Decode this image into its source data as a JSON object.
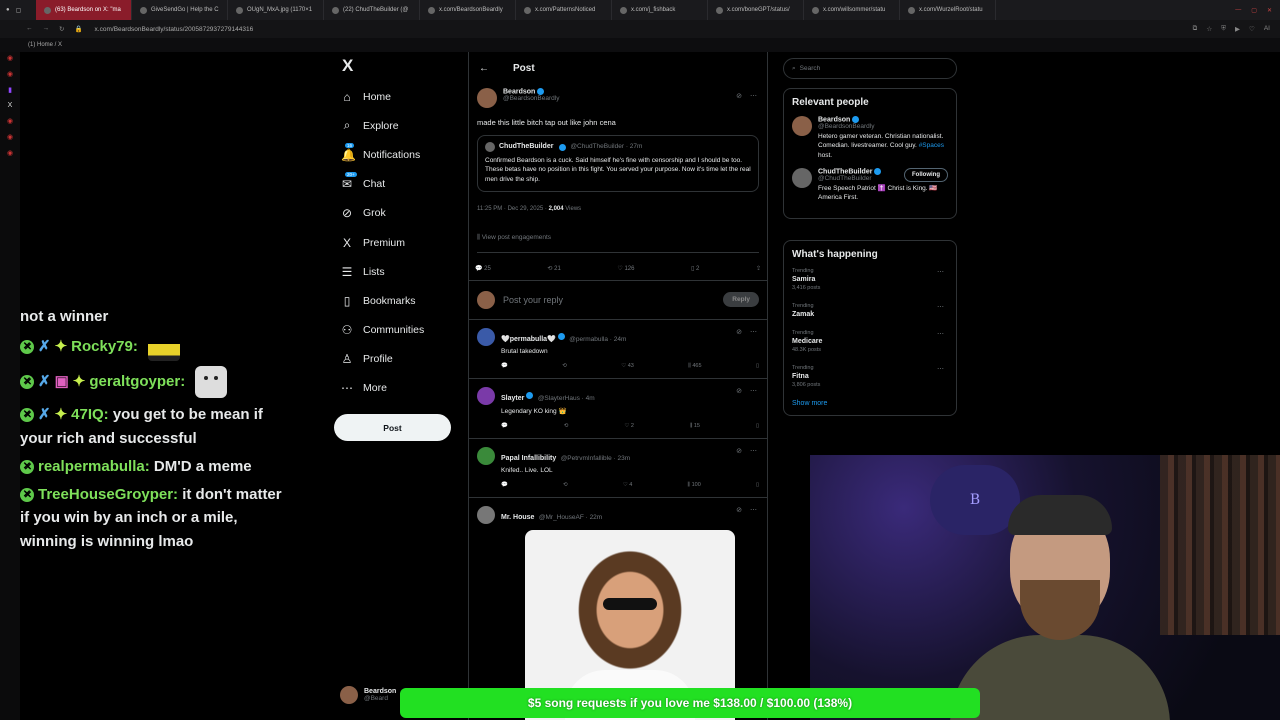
{
  "browser": {
    "tabs": [
      {
        "label": "(63) Beardson on X: \"ma",
        "active": true
      },
      {
        "label": "GiveSendGo | Help the C",
        "active": false
      },
      {
        "label": "OUgN_MxA.jpg (1170×1",
        "active": false
      },
      {
        "label": "(22) ChudTheBuilder (@",
        "active": false
      },
      {
        "label": "x.com/BeardsonBeardly",
        "active": false
      },
      {
        "label": "x.com/PatternsNoticed",
        "active": false
      },
      {
        "label": "x.com/j_fishback",
        "active": false
      },
      {
        "label": "x.com/boneGPT/status/",
        "active": false
      },
      {
        "label": "x.com/willsommer/statu",
        "active": false
      },
      {
        "label": "x.com/WurzelRoot/statu",
        "active": false
      }
    ],
    "url": "x.com/BeardsonBeardly/status/2005872937279144316",
    "bookmark": "(1) Home / X"
  },
  "chat": {
    "messages": [
      {
        "user": "",
        "text": "not a winner"
      },
      {
        "user": "Rocky79:",
        "text": ""
      },
      {
        "user": "geraltgoyper:",
        "text": ""
      },
      {
        "user": "47IQ:",
        "text": "you get to be mean if your rich and successful"
      },
      {
        "user": "realpermabulla:",
        "text": "DM'D a meme"
      },
      {
        "user": "TreeHouseGroyper:",
        "text": "it don't matter if you win by an inch or a mile, winning is winning lmao"
      }
    ]
  },
  "xnav": {
    "logo": "X",
    "items": [
      {
        "label": "Home",
        "icon": "home-icon",
        "glyph": "⌂"
      },
      {
        "label": "Explore",
        "icon": "search-icon",
        "glyph": "⌕"
      },
      {
        "label": "Notifications",
        "icon": "bell-icon",
        "glyph": "🔔",
        "count": "16"
      },
      {
        "label": "Chat",
        "icon": "chat-icon",
        "glyph": "✉",
        "count": "20+"
      },
      {
        "label": "Grok",
        "icon": "grok-icon",
        "glyph": "⊘"
      },
      {
        "label": "Premium",
        "icon": "x-icon",
        "glyph": "X"
      },
      {
        "label": "Lists",
        "icon": "list-icon",
        "glyph": "☰"
      },
      {
        "label": "Bookmarks",
        "icon": "bookmark-icon",
        "glyph": "▯"
      },
      {
        "label": "Communities",
        "icon": "people-icon",
        "glyph": "⚇"
      },
      {
        "label": "Profile",
        "icon": "person-icon",
        "glyph": "♙"
      },
      {
        "label": "More",
        "icon": "more-icon",
        "glyph": "⋯"
      }
    ],
    "post_button": "Post",
    "account": {
      "name": "Beardson",
      "handle": "@Beard"
    }
  },
  "main": {
    "header": "Post",
    "tweet": {
      "name": "Beardson",
      "handle": "@BeardsonBeardly",
      "text": "made this little bitch tap out like john cena",
      "quote": {
        "name": "ChudTheBuilder",
        "handle": "@ChudTheBuilder · 27m",
        "text": "Confirmed Beardson is a cuck. Said himself he's fine with censorship and I should be too. These betas have no position in this fight. You served your purpose. Now it's time let the real men drive the ship."
      },
      "time": "11:25 PM · Dec 29, 2025 · ",
      "views": "2,004",
      "views_label": " Views",
      "engagements": "View post engagements",
      "counts": {
        "replies": "25",
        "reposts": "21",
        "likes": "126",
        "bookmarks": "2"
      }
    },
    "reply_placeholder": "Post your reply",
    "reply_button": "Reply",
    "replies": [
      {
        "name": "🤍permabulla🤍",
        "handle": "@permabulla · 24m",
        "text": "Brutal takedown",
        "likes": "43",
        "views": "465",
        "avatar": "#3a5aa8"
      },
      {
        "name": "Slayter",
        "handle": "@SlayterHaus · 4m",
        "text": "Legendary KO king 👑",
        "likes": "2",
        "views": "15",
        "avatar": "#7a3aa8"
      },
      {
        "name": "Papal Infallibility",
        "handle": "@PetrvmInfallible · 23m",
        "text": "Knifed.. Live. LOL",
        "likes": "4",
        "views": "100",
        "avatar": "#3a8a3a"
      },
      {
        "name": "Mr. House",
        "handle": "@Mr_HouseAF · 22m",
        "text": "",
        "likes": "",
        "views": "",
        "avatar": "#777"
      }
    ]
  },
  "right": {
    "search_placeholder": "Search",
    "relevant_title": "Relevant people",
    "people": [
      {
        "name": "Beardson",
        "handle": "@BeardsonBeardly",
        "bio_pre": "Hetero gamer veteran. Christian nationalist. Comedian. livestreamer. Cool guy. ",
        "bio_link": "#Spaces",
        "bio_post": " host."
      },
      {
        "name": "ChudTheBuilder",
        "handle": "@ChudTheBuilder",
        "bio_pre": "Free Speech Patriot ✝️ Christ is King. 🇺🇸America First.",
        "bio_link": "",
        "bio_post": "",
        "follow": "Following"
      }
    ],
    "happening_title": "What's happening",
    "trends": [
      {
        "label": "Trending",
        "name": "Samira",
        "posts": "3,416 posts"
      },
      {
        "label": "Trending",
        "name": "Zamak",
        "posts": ""
      },
      {
        "label": "Trending",
        "name": "Medicare",
        "posts": "48.3K posts"
      },
      {
        "label": "Trending",
        "name": "Fitna",
        "posts": "3,806 posts"
      }
    ],
    "show_more": "Show more"
  },
  "overlay": {
    "donation": "$5 song requests if you love me $138.00 / $100.00 (138%)"
  },
  "colors": {
    "accent": "#1d9bf0",
    "chat_name": "#7ee05a",
    "donation": "#22e022"
  }
}
